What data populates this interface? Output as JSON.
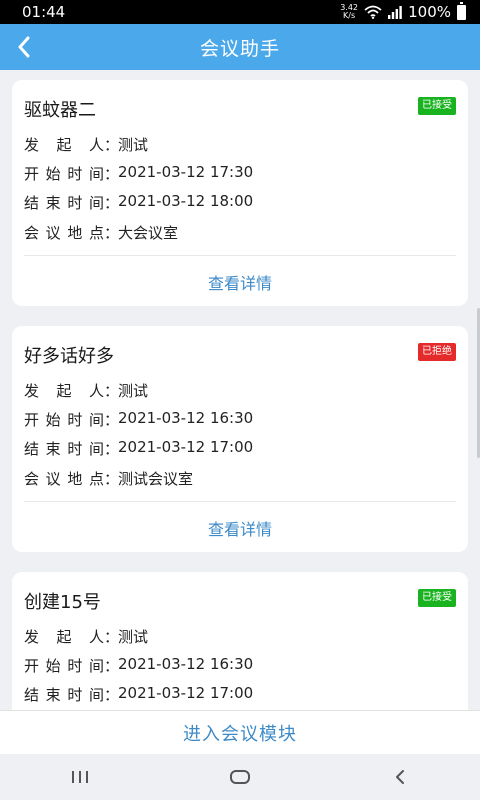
{
  "status_bar": {
    "time": "01:44",
    "net_speed_value": "3.42",
    "net_speed_unit": "K/s",
    "battery": "100%"
  },
  "app_bar": {
    "title": "会议助手"
  },
  "meetings": [
    {
      "title": "驱蚊器二",
      "status": "已接受",
      "status_color": "#19b31f",
      "initiator_label": "发 起 人",
      "initiator": "测试",
      "start_label": "开始时间",
      "start": "2021-03-12 17:30",
      "end_label": "结束时间",
      "end": "2021-03-12 18:00",
      "location_label": "会议地点",
      "location": "大会议室",
      "detail_label": "查看详情"
    },
    {
      "title": "好多话好多",
      "status": "已拒绝",
      "status_color": "#e42a2a",
      "initiator_label": "发 起 人",
      "initiator": "测试",
      "start_label": "开始时间",
      "start": "2021-03-12 16:30",
      "end_label": "结束时间",
      "end": "2021-03-12 17:00",
      "location_label": "会议地点",
      "location": "测试会议室",
      "detail_label": "查看详情"
    },
    {
      "title": "创建15号",
      "status": "已接受",
      "status_color": "#19b31f",
      "initiator_label": "发 起 人",
      "initiator": "测试",
      "start_label": "开始时间",
      "start": "2021-03-12 16:30",
      "end_label": "结束时间",
      "end": "2021-03-12 17:00"
    }
  ],
  "colon": "：",
  "bottom_button": {
    "label": "进入会议模块"
  },
  "colors": {
    "app_bar": "#4aa8eb",
    "link": "#3d8ac8",
    "accepted": "#19b31f",
    "rejected": "#e42a2a"
  },
  "icons": {
    "back": "back-arrow-icon",
    "nav_recent": "recent-apps-icon",
    "nav_home": "home-icon",
    "nav_back": "nav-back-icon"
  }
}
